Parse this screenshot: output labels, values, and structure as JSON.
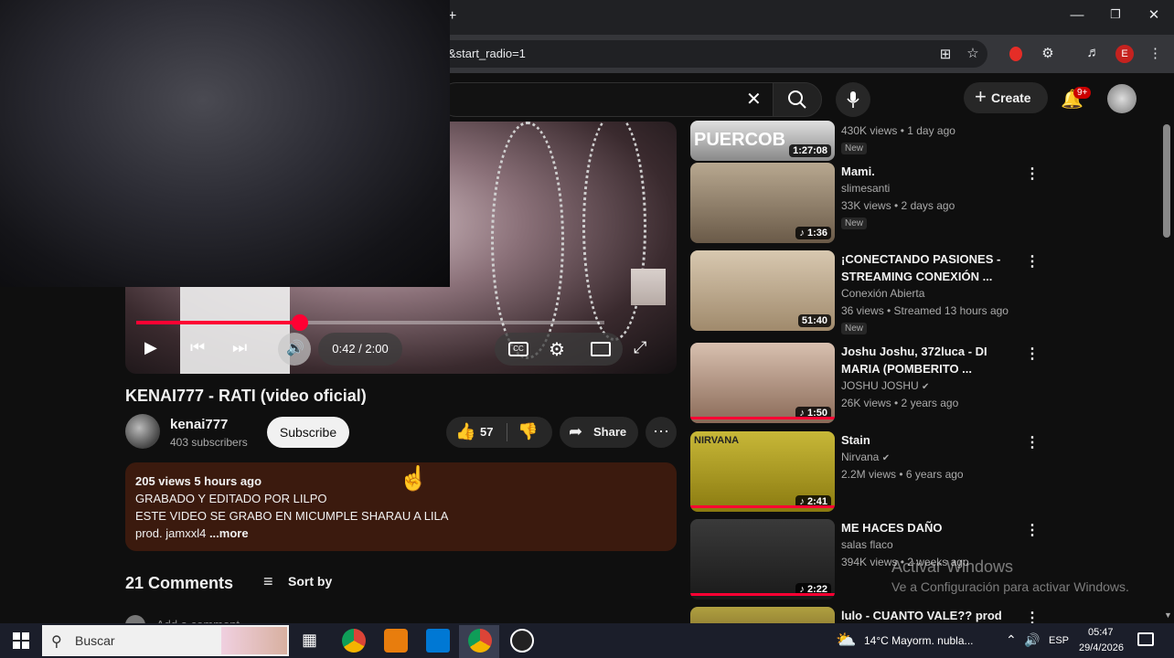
{
  "browser": {
    "url_fragment": "&start_radio=1",
    "new_tab": "+",
    "profile_initial": "E"
  },
  "header": {
    "create_label": "Create",
    "notif_badge": "9+"
  },
  "player": {
    "time": "0:42 / 2:00",
    "progress_fraction": 0.35
  },
  "video": {
    "title": "KENAI777 - RATI (video oficial)",
    "channel": "kenai777",
    "subscribers": "403 subscribers",
    "subscribe_label": "Subscribe",
    "likes": "57",
    "share_label": "Share"
  },
  "description": {
    "stats": "205 views  5 hours ago",
    "line1": "GRABADO Y EDITADO POR LILPO",
    "line2": "ESTE VIDEO SE GRABO EN MICUMPLE SHARAU A LILA",
    "line3": "prod. jamxxl4",
    "more": "...more"
  },
  "comments": {
    "title": "21 Comments",
    "sort_label": "Sort by",
    "add_comment": "Add a comment..."
  },
  "recommendations": [
    {
      "title": "",
      "thumb_text": "PUERCOB",
      "channel": "",
      "meta": "430K views • 1 day ago",
      "duration": "1:27:08",
      "badge": "New",
      "music": false
    },
    {
      "title": "Mami.",
      "channel": "slimesanti",
      "meta": "33K views • 2 days ago",
      "duration": "1:36",
      "badge": "New",
      "music": true
    },
    {
      "title": "¡CONECTANDO PASIONES - STREAMING CONEXIÓN ...",
      "channel": "Conexión Abierta",
      "meta": "36 views • Streamed 13 hours ago",
      "duration": "51:40",
      "badge": "New",
      "music": false
    },
    {
      "title": "Joshu Joshu, 372luca - DI MARIA (POMBERITO ...",
      "channel": "JOSHU JOSHU",
      "meta": "26K views • 2 years ago",
      "duration": "1:50",
      "badge": "",
      "music": true
    },
    {
      "title": "Stain",
      "channel": "Nirvana",
      "meta": "2.2M views • 6 years ago",
      "duration": "2:41",
      "badge": "",
      "music": true,
      "thumb_text": "NIRVANA"
    },
    {
      "title": "ME HACES DAÑO",
      "channel": "salas flaco",
      "meta": "394K views • 2 weeks ago",
      "duration": "2:22",
      "badge": "",
      "music": true
    },
    {
      "title": "lulo - CUANTO VALE?? prod",
      "channel": "",
      "meta": "",
      "duration": "",
      "badge": "",
      "music": false
    }
  ],
  "watermark": {
    "line1": "Activar Windows",
    "line2": "Ve a Configuración para activar Windows."
  },
  "taskbar": {
    "search_placeholder": "Buscar",
    "weather": "14°C  Mayorm. nubla...",
    "lang": "ESP",
    "time": "05:47",
    "date": "29/4/2026"
  }
}
